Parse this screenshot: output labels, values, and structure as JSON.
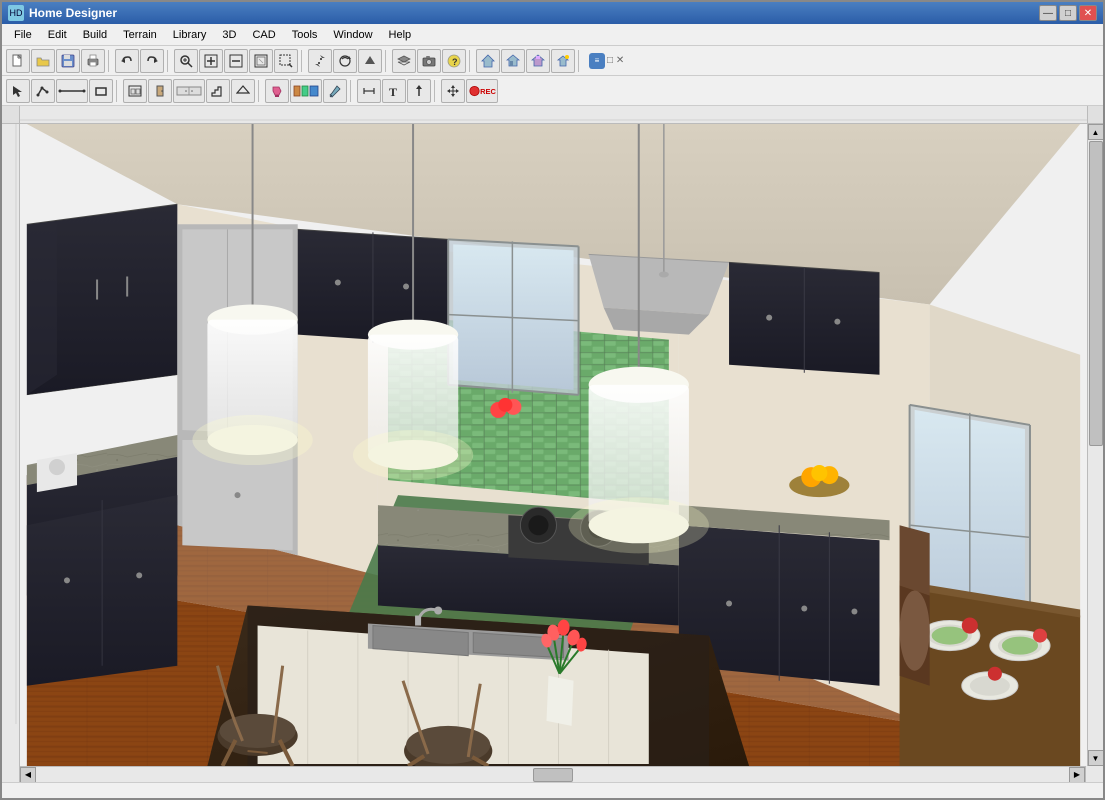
{
  "window": {
    "title": "Home Designer",
    "icon_label": "HD"
  },
  "title_controls": {
    "minimize": "—",
    "maximize": "□",
    "close": "✕"
  },
  "menu": {
    "items": [
      "File",
      "Edit",
      "Build",
      "Terrain",
      "Library",
      "3D",
      "CAD",
      "Tools",
      "Window",
      "Help"
    ]
  },
  "toolbar1": {
    "buttons": [
      {
        "name": "new",
        "icon": "📄"
      },
      {
        "name": "open",
        "icon": "📂"
      },
      {
        "name": "save",
        "icon": "💾"
      },
      {
        "name": "print",
        "icon": "🖨"
      },
      {
        "name": "undo",
        "icon": "↩"
      },
      {
        "name": "redo",
        "icon": "↪"
      },
      {
        "name": "zoom-in-glass",
        "icon": "🔍"
      },
      {
        "name": "zoom-in",
        "icon": "+"
      },
      {
        "name": "zoom-out",
        "icon": "−"
      },
      {
        "name": "fit",
        "icon": "⊞"
      },
      {
        "name": "zoom-box",
        "icon": "⊡"
      },
      {
        "name": "pan",
        "icon": "✋"
      },
      {
        "name": "rotate",
        "icon": "⟳"
      },
      {
        "name": "arrow-up",
        "icon": "↑"
      },
      {
        "name": "layers",
        "icon": "☰"
      },
      {
        "name": "camera",
        "icon": "📷"
      },
      {
        "name": "question",
        "icon": "?"
      },
      {
        "name": "house-basic",
        "icon": "⌂"
      },
      {
        "name": "house-view",
        "icon": "⌂"
      },
      {
        "name": "house-3d",
        "icon": "⌂"
      },
      {
        "name": "house-sun",
        "icon": "⌂"
      }
    ]
  },
  "toolbar2": {
    "buttons": [
      {
        "name": "select",
        "icon": "↖"
      },
      {
        "name": "polyline",
        "icon": "⌐"
      },
      {
        "name": "line-tool",
        "icon": "—"
      },
      {
        "name": "rectangle",
        "icon": "▭"
      },
      {
        "name": "house-tool",
        "icon": "⌂"
      },
      {
        "name": "door",
        "icon": "🚪"
      },
      {
        "name": "cabinet",
        "icon": "▤"
      },
      {
        "name": "stairs",
        "icon": "≡"
      },
      {
        "name": "roof",
        "icon": "△"
      },
      {
        "name": "paint",
        "icon": "🖊"
      },
      {
        "name": "material",
        "icon": "🎨"
      },
      {
        "name": "eyedrop",
        "icon": "💧"
      },
      {
        "name": "dimension",
        "icon": "↔"
      },
      {
        "name": "text",
        "icon": "T"
      },
      {
        "name": "arrow",
        "icon": "↑"
      },
      {
        "name": "move",
        "icon": "✥"
      },
      {
        "name": "record",
        "icon": "⏺"
      }
    ]
  },
  "scene": {
    "description": "3D kitchen rendering with dark cabinets, granite countertops, green tile backsplash, hardwood floors, kitchen island with sink"
  },
  "scrollbar": {
    "up_arrow": "▲",
    "down_arrow": "▼",
    "left_arrow": "◀",
    "right_arrow": "▶"
  }
}
